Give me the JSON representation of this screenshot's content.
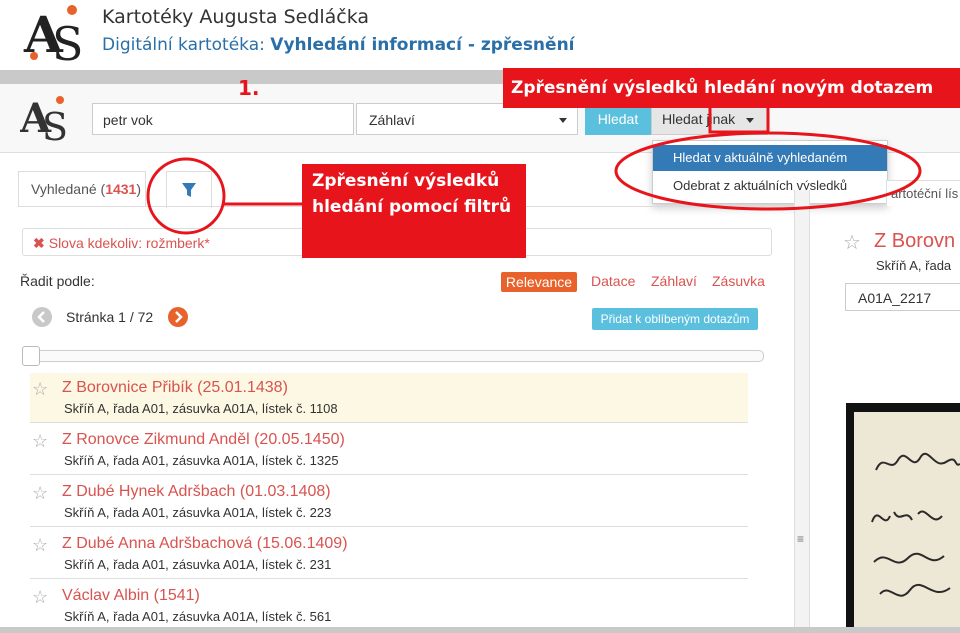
{
  "slide": {
    "title": "Kartotéky Augusta Sedláčka",
    "subtitle_prefix": "Digitální kartotéka: ",
    "subtitle_bold": "Vyhledání informací - zpřesnění"
  },
  "annotations": {
    "step": "1.",
    "top_callout": "Zpřesnění výsledků hledání novým dotazem",
    "left_callout": "Zpřesnění výsledků hledání pomocí filtrů"
  },
  "search": {
    "query_value": "petr vok",
    "scope_value": "Záhlaví",
    "search_button": "Hledat",
    "other_button": "Hledat jinak"
  },
  "dropdown": {
    "items": [
      "Hledat v aktuálně vyhledaném",
      "Odebrat z aktuálních výsledků"
    ]
  },
  "tabs": {
    "found_label": "Vyhledané (",
    "found_count": "1431",
    "found_close": ")"
  },
  "query_chip": "Slova kdekoliv: rožmberk*",
  "sort": {
    "label": "Řadit podle:",
    "options": [
      "Relevance",
      "Datace",
      "Záhlaví",
      "Zásuvka"
    ],
    "active": "Relevance"
  },
  "pagination": {
    "text": "Stránka 1 / 72"
  },
  "favorite_button": "Přidat k oblíbeným dotazům",
  "results": [
    {
      "title": "Z Borovnice Přibík (25.01.1438)",
      "subtitle": "Skříň A, řada A01, zásuvka A01A, lístek č. 1108"
    },
    {
      "title": "Z Ronovce Zikmund Anděl (20.05.1450)",
      "subtitle": "Skříň A, řada A01, zásuvka A01A, lístek č. 1325"
    },
    {
      "title": "Z Dubé Hynek Adršbach (01.03.1408)",
      "subtitle": "Skříň A, řada A01, zásuvka A01A, lístek č. 223"
    },
    {
      "title": "Z Dubé Anna Adršbachová (15.06.1409)",
      "subtitle": "Skříň A, řada A01, zásuvka A01A, lístek č. 231"
    },
    {
      "title": "Václav Albin (1541)",
      "subtitle": "Skříň A, řada A01, zásuvka A01A, lístek č. 561"
    }
  ],
  "detail": {
    "tab_label": "artotéční lís",
    "title": "Z Borovn",
    "subtitle": "Skříň A, řada",
    "code": "A01A_2217"
  },
  "colors": {
    "accent_red": "#d9534f",
    "callout_red": "#e8141c",
    "info_blue": "#5bc0de",
    "primary_blue": "#337ab7",
    "orange": "#e8632b"
  }
}
